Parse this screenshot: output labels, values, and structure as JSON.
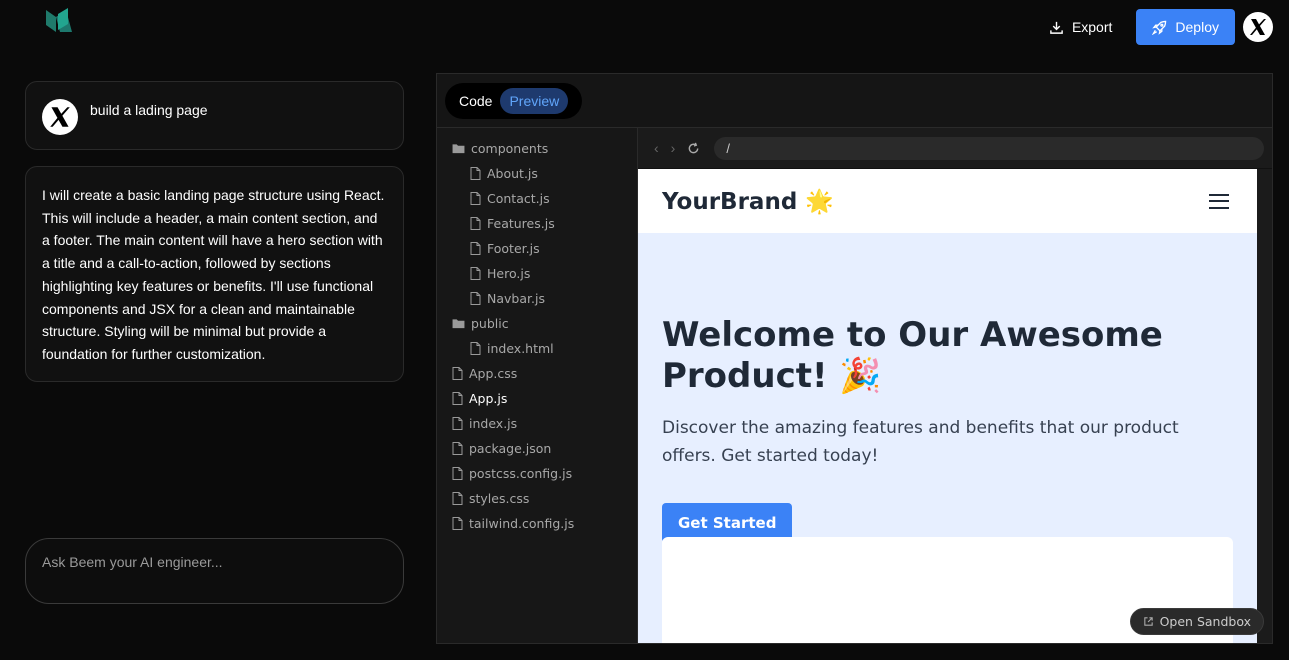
{
  "topbar": {
    "export_label": "Export",
    "deploy_label": "Deploy"
  },
  "chat": {
    "user_message": "build a lading page",
    "ai_message": "I will create a basic landing page structure using React. This will include a header, a main content section, and a footer. The main content will have a hero section with a title and a call-to-action, followed by sections highlighting key features or benefits. I'll use functional components and JSX for a clean and maintainable structure. Styling will be minimal but provide a foundation for further customization.",
    "input_placeholder": "Ask Beem your AI engineer..."
  },
  "workspace": {
    "tabs": [
      {
        "label": "Code"
      },
      {
        "label": "Preview",
        "active": true
      }
    ],
    "files": [
      {
        "label": "components",
        "type": "folder",
        "depth": 0
      },
      {
        "label": "About.js",
        "type": "file",
        "depth": 1
      },
      {
        "label": "Contact.js",
        "type": "file",
        "depth": 1
      },
      {
        "label": "Features.js",
        "type": "file",
        "depth": 1
      },
      {
        "label": "Footer.js",
        "type": "file",
        "depth": 1
      },
      {
        "label": "Hero.js",
        "type": "file",
        "depth": 1
      },
      {
        "label": "Navbar.js",
        "type": "file",
        "depth": 1
      },
      {
        "label": "public",
        "type": "folder",
        "depth": 0
      },
      {
        "label": "index.html",
        "type": "file",
        "depth": 1
      },
      {
        "label": "App.css",
        "type": "file",
        "depth": 0
      },
      {
        "label": "App.js",
        "type": "file",
        "depth": 0,
        "active": true
      },
      {
        "label": "index.js",
        "type": "file",
        "depth": 0
      },
      {
        "label": "package.json",
        "type": "file",
        "depth": 0
      },
      {
        "label": "postcss.config.js",
        "type": "file",
        "depth": 0
      },
      {
        "label": "styles.css",
        "type": "file",
        "depth": 0
      },
      {
        "label": "tailwind.config.js",
        "type": "file",
        "depth": 0
      }
    ],
    "url": "/",
    "open_sandbox_label": "Open Sandbox"
  },
  "preview": {
    "brand": "YourBrand 🌟",
    "hero_title": "Welcome to Our Awesome Product! 🎉",
    "hero_subtitle": "Discover the amazing features and benefits that our product offers. Get started today!",
    "cta_label": "Get Started"
  },
  "colors": {
    "accent": "#3b82f6",
    "background": "#0a0a0a",
    "preview_bg": "#e7efff"
  }
}
